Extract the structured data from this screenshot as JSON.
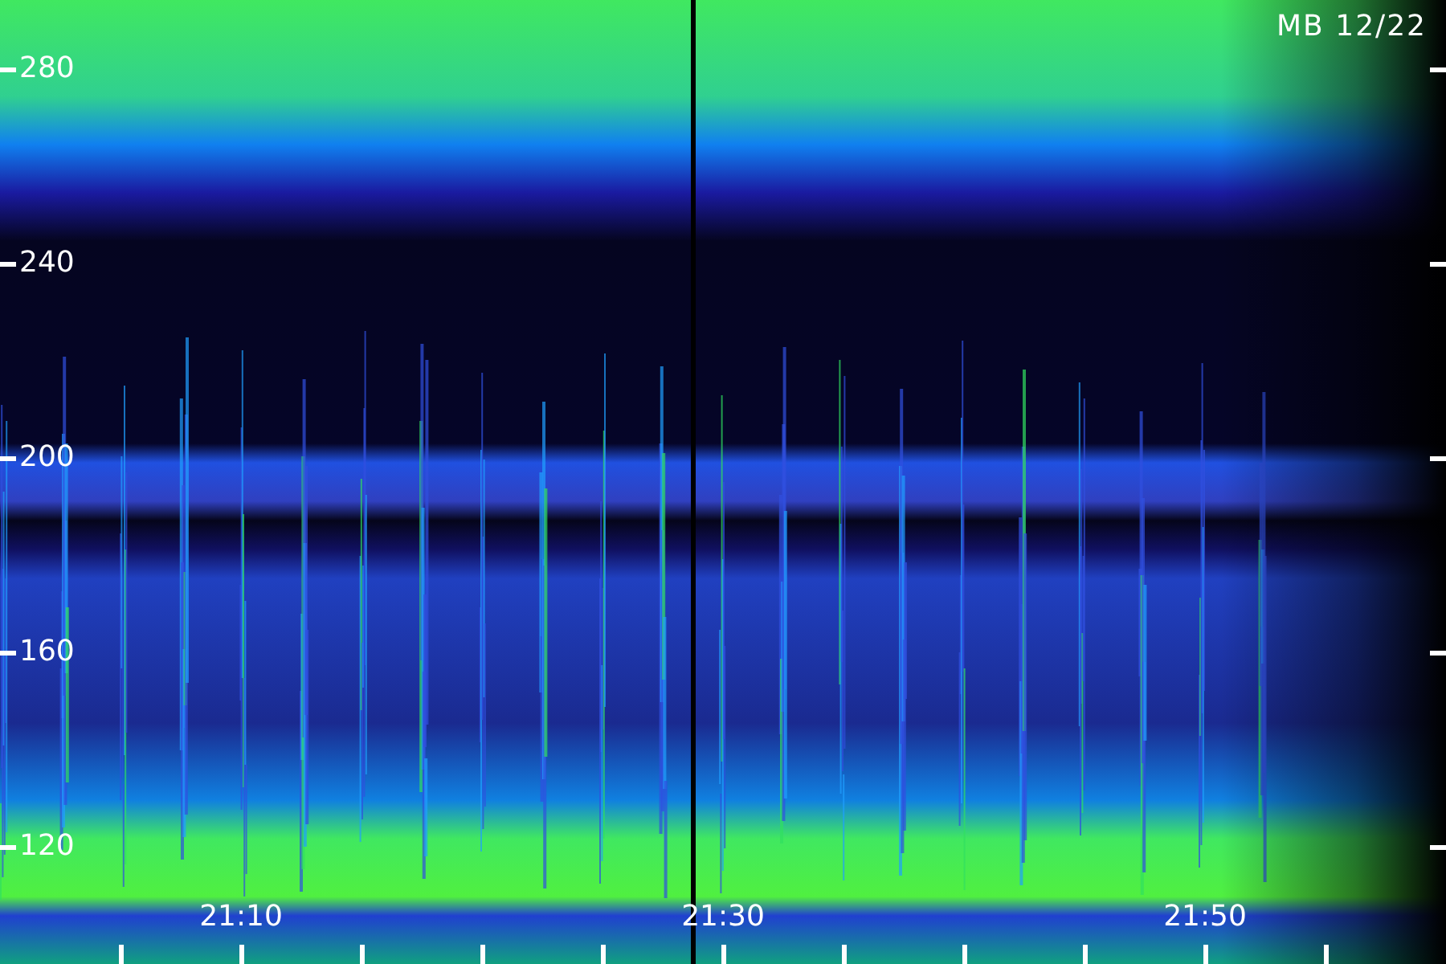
{
  "title": "MB 12/22",
  "y_axis": {
    "ticks": [
      "280",
      "240",
      "200",
      "160",
      "120"
    ]
  },
  "x_axis": {
    "ticks": [
      "21:10",
      "21:30",
      "21:50"
    ]
  }
}
